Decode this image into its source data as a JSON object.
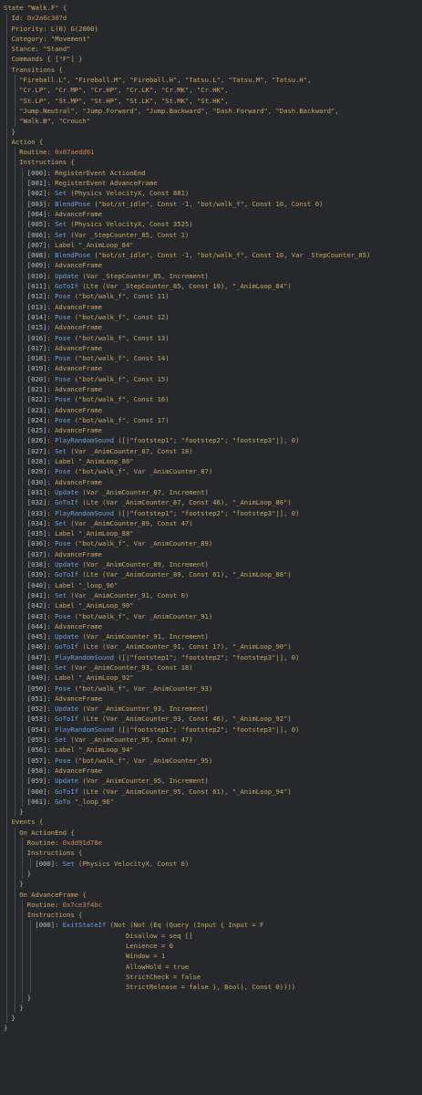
{
  "lines": [
    {
      "d": 0,
      "s": [
        [
          "k",
          "State \"Walk.F\" {"
        ]
      ]
    },
    {
      "d": 1,
      "s": [
        [
          "k",
          "Id: "
        ],
        [
          "n",
          "0x2a6c307d"
        ]
      ]
    },
    {
      "d": 1,
      "s": [
        [
          "k",
          "Priority: L(0) G(2000)"
        ]
      ]
    },
    {
      "d": 1,
      "s": [
        [
          "k",
          "Category: \"Movement\""
        ]
      ]
    },
    {
      "d": 1,
      "s": [
        [
          "k",
          "Stance: \"Stand\""
        ]
      ]
    },
    {
      "d": 1,
      "s": [
        [
          "k",
          "Commands { [\"F\"] }"
        ]
      ]
    },
    {
      "d": 1,
      "s": [
        [
          "k",
          "Transitions {"
        ]
      ]
    },
    {
      "d": 2,
      "s": [
        [
          "s",
          "\"Fireball.L\", \"Fireball.M\", \"Fireball.H\", \"Tatsu.L\", \"Tatsu.M\", \"Tatsu.H\","
        ]
      ]
    },
    {
      "d": 2,
      "s": [
        [
          "s",
          "\"Cr.LP\", \"Cr.MP\", \"Cr.HP\", \"Cr.LK\", \"Cr.MK\", \"Cr.HK\","
        ]
      ]
    },
    {
      "d": 2,
      "s": [
        [
          "s",
          "\"St.LP\", \"St.MP\", \"St.HP\", \"St.LK\", \"St.MK\", \"St.HK\","
        ]
      ]
    },
    {
      "d": 2,
      "s": [
        [
          "s",
          "\"Jump.Neutral\", \"Jump.Forward\", \"Jump.Backward\", \"Dash.Forward\", \"Dash.Backward\","
        ]
      ]
    },
    {
      "d": 2,
      "s": [
        [
          "s",
          "\"Walk.B\", \"Crouch\""
        ]
      ]
    },
    {
      "d": 1,
      "s": [
        [
          "p",
          "}"
        ]
      ]
    },
    {
      "d": 1,
      "s": [
        [
          "k",
          "Action {"
        ]
      ]
    },
    {
      "d": 2,
      "s": [
        [
          "k",
          "Routine: "
        ],
        [
          "n",
          "0x87aedd61"
        ]
      ]
    },
    {
      "d": 2,
      "s": [
        [
          "k",
          "Instructions {"
        ]
      ]
    },
    {
      "d": 3,
      "s": [
        [
          "p",
          "[000]: "
        ],
        [
          "k",
          "RegisterEvent ActionEnd"
        ]
      ]
    },
    {
      "d": 3,
      "s": [
        [
          "p",
          "[001]: "
        ],
        [
          "k",
          "RegisterEvent AdvanceFrame"
        ]
      ]
    },
    {
      "d": 3,
      "s": [
        [
          "p",
          "[002]: "
        ],
        [
          "b",
          "Set"
        ],
        [
          "k",
          " (Physics VelocityX, Const 881)"
        ]
      ]
    },
    {
      "d": 3,
      "s": [
        [
          "p",
          "[003]: "
        ],
        [
          "b",
          "BlendPose"
        ],
        [
          "k",
          " (\"bot/st_idle\", Const -1, \"bot/walk_f\", Const 10, Const 0)"
        ]
      ]
    },
    {
      "d": 3,
      "s": [
        [
          "p",
          "[004]: "
        ],
        [
          "k",
          "AdvanceFrame"
        ]
      ]
    },
    {
      "d": 3,
      "s": [
        [
          "p",
          "[005]: "
        ],
        [
          "b",
          "Set"
        ],
        [
          "k",
          " (Physics VelocityX, Const 3525)"
        ]
      ]
    },
    {
      "d": 3,
      "s": [
        [
          "p",
          "[006]: "
        ],
        [
          "b",
          "Set"
        ],
        [
          "k",
          " (Var _StepCounter_85, Const 1)"
        ]
      ]
    },
    {
      "d": 3,
      "s": [
        [
          "p",
          "[007]: "
        ],
        [
          "k",
          "Label \"_AnimLoop_84\""
        ]
      ]
    },
    {
      "d": 3,
      "s": [
        [
          "p",
          "[008]: "
        ],
        [
          "b",
          "BlendPose"
        ],
        [
          "k",
          " (\"bot/st_idle\", Const -1, \"bot/walk_f\", Const 10, Var _StepCounter_85)"
        ]
      ]
    },
    {
      "d": 3,
      "s": [
        [
          "p",
          "[009]: "
        ],
        [
          "k",
          "AdvanceFrame"
        ]
      ]
    },
    {
      "d": 3,
      "s": [
        [
          "p",
          "[010]: "
        ],
        [
          "b",
          "Update"
        ],
        [
          "k",
          " (Var _StepCounter_85, Increment)"
        ]
      ]
    },
    {
      "d": 3,
      "s": [
        [
          "p",
          "[011]: "
        ],
        [
          "b",
          "GoToIf"
        ],
        [
          "k",
          " (Lte (Var _StepCounter_85, Const 10), \"_AnimLoop_84\")"
        ]
      ]
    },
    {
      "d": 3,
      "s": [
        [
          "p",
          "[012]: "
        ],
        [
          "b",
          "Pose"
        ],
        [
          "k",
          " (\"bot/walk_f\", Const 11)"
        ]
      ]
    },
    {
      "d": 3,
      "s": [
        [
          "p",
          "[013]: "
        ],
        [
          "k",
          "AdvanceFrame"
        ]
      ]
    },
    {
      "d": 3,
      "s": [
        [
          "p",
          "[014]: "
        ],
        [
          "b",
          "Pose"
        ],
        [
          "k",
          " (\"bot/walk_f\", Const 12)"
        ]
      ]
    },
    {
      "d": 3,
      "s": [
        [
          "p",
          "[015]: "
        ],
        [
          "k",
          "AdvanceFrame"
        ]
      ]
    },
    {
      "d": 3,
      "s": [
        [
          "p",
          "[016]: "
        ],
        [
          "b",
          "Pose"
        ],
        [
          "k",
          " (\"bot/walk_f\", Const 13)"
        ]
      ]
    },
    {
      "d": 3,
      "s": [
        [
          "p",
          "[017]: "
        ],
        [
          "k",
          "AdvanceFrame"
        ]
      ]
    },
    {
      "d": 3,
      "s": [
        [
          "p",
          "[018]: "
        ],
        [
          "b",
          "Pose"
        ],
        [
          "k",
          " (\"bot/walk_f\", Const 14)"
        ]
      ]
    },
    {
      "d": 3,
      "s": [
        [
          "p",
          "[019]: "
        ],
        [
          "k",
          "AdvanceFrame"
        ]
      ]
    },
    {
      "d": 3,
      "s": [
        [
          "p",
          "[020]: "
        ],
        [
          "b",
          "Pose"
        ],
        [
          "k",
          " (\"bot/walk_f\", Const 15)"
        ]
      ]
    },
    {
      "d": 3,
      "s": [
        [
          "p",
          "[021]: "
        ],
        [
          "k",
          "AdvanceFrame"
        ]
      ]
    },
    {
      "d": 3,
      "s": [
        [
          "p",
          "[022]: "
        ],
        [
          "b",
          "Pose"
        ],
        [
          "k",
          " (\"bot/walk_f\", Const 16)"
        ]
      ]
    },
    {
      "d": 3,
      "s": [
        [
          "p",
          "[023]: "
        ],
        [
          "k",
          "AdvanceFrame"
        ]
      ]
    },
    {
      "d": 3,
      "s": [
        [
          "p",
          "[024]: "
        ],
        [
          "b",
          "Pose"
        ],
        [
          "k",
          " (\"bot/walk_f\", Const 17)"
        ]
      ]
    },
    {
      "d": 3,
      "s": [
        [
          "p",
          "[025]: "
        ],
        [
          "k",
          "AdvanceFrame"
        ]
      ]
    },
    {
      "d": 3,
      "s": [
        [
          "p",
          "[026]: "
        ],
        [
          "b",
          "PlayRandomSound"
        ],
        [
          "k",
          " ([|\"footstep1\"; \"footstep2\"; \"footstep3\"|], 0)"
        ]
      ]
    },
    {
      "d": 3,
      "s": [
        [
          "p",
          "[027]: "
        ],
        [
          "b",
          "Set"
        ],
        [
          "k",
          " (Var _AnimCounter_87, Const 18)"
        ]
      ]
    },
    {
      "d": 3,
      "s": [
        [
          "p",
          "[028]: "
        ],
        [
          "k",
          "Label \"_AnimLoop_86\""
        ]
      ]
    },
    {
      "d": 3,
      "s": [
        [
          "p",
          "[029]: "
        ],
        [
          "b",
          "Pose"
        ],
        [
          "k",
          " (\"bot/walk_f\", Var _AnimCounter_87)"
        ]
      ]
    },
    {
      "d": 3,
      "s": [
        [
          "p",
          "[030]: "
        ],
        [
          "k",
          "AdvanceFrame"
        ]
      ]
    },
    {
      "d": 3,
      "s": [
        [
          "p",
          "[031]: "
        ],
        [
          "b",
          "Update"
        ],
        [
          "k",
          " (Var _AnimCounter_87, Increment)"
        ]
      ]
    },
    {
      "d": 3,
      "s": [
        [
          "p",
          "[032]: "
        ],
        [
          "b",
          "GoToIf"
        ],
        [
          "k",
          " (Lte (Var _AnimCounter_87, Const 46), \"_AnimLoop_86\")"
        ]
      ]
    },
    {
      "d": 3,
      "s": [
        [
          "p",
          "[033]: "
        ],
        [
          "b",
          "PlayRandomSound"
        ],
        [
          "k",
          " ([|\"footstep1\"; \"footstep2\"; \"footstep3\"|], 0)"
        ]
      ]
    },
    {
      "d": 3,
      "s": [
        [
          "p",
          "[034]: "
        ],
        [
          "b",
          "Set"
        ],
        [
          "k",
          " (Var _AnimCounter_89, Const 47)"
        ]
      ]
    },
    {
      "d": 3,
      "s": [
        [
          "p",
          "[035]: "
        ],
        [
          "k",
          "Label \"_AnimLoop_88\""
        ]
      ]
    },
    {
      "d": 3,
      "s": [
        [
          "p",
          "[036]: "
        ],
        [
          "b",
          "Pose"
        ],
        [
          "k",
          " (\"bot/walk_f\", Var _AnimCounter_89)"
        ]
      ]
    },
    {
      "d": 3,
      "s": [
        [
          "p",
          "[037]: "
        ],
        [
          "k",
          "AdvanceFrame"
        ]
      ]
    },
    {
      "d": 3,
      "s": [
        [
          "p",
          "[038]: "
        ],
        [
          "b",
          "Update"
        ],
        [
          "k",
          " (Var _AnimCounter_89, Increment)"
        ]
      ]
    },
    {
      "d": 3,
      "s": [
        [
          "p",
          "[039]: "
        ],
        [
          "b",
          "GoToIf"
        ],
        [
          "k",
          " (Lte (Var _AnimCounter_89, Const 61), \"_AnimLoop_88\")"
        ]
      ]
    },
    {
      "d": 3,
      "s": [
        [
          "p",
          "[040]: "
        ],
        [
          "k",
          "Label \"_loop_96\""
        ]
      ]
    },
    {
      "d": 3,
      "s": [
        [
          "p",
          "[041]: "
        ],
        [
          "b",
          "Set"
        ],
        [
          "k",
          " (Var _AnimCounter_91, Const 0)"
        ]
      ]
    },
    {
      "d": 3,
      "s": [
        [
          "p",
          "[042]: "
        ],
        [
          "k",
          "Label \"_AnimLoop_90\""
        ]
      ]
    },
    {
      "d": 3,
      "s": [
        [
          "p",
          "[043]: "
        ],
        [
          "b",
          "Pose"
        ],
        [
          "k",
          " (\"bot/walk_f\", Var _AnimCounter_91)"
        ]
      ]
    },
    {
      "d": 3,
      "s": [
        [
          "p",
          "[044]: "
        ],
        [
          "k",
          "AdvanceFrame"
        ]
      ]
    },
    {
      "d": 3,
      "s": [
        [
          "p",
          "[045]: "
        ],
        [
          "b",
          "Update"
        ],
        [
          "k",
          " (Var _AnimCounter_91, Increment)"
        ]
      ]
    },
    {
      "d": 3,
      "s": [
        [
          "p",
          "[046]: "
        ],
        [
          "b",
          "GoToIf"
        ],
        [
          "k",
          " (Lte (Var _AnimCounter_91, Const 17), \"_AnimLoop_90\")"
        ]
      ]
    },
    {
      "d": 3,
      "s": [
        [
          "p",
          "[047]: "
        ],
        [
          "b",
          "PlayRandomSound"
        ],
        [
          "k",
          " ([|\"footstep1\"; \"footstep2\"; \"footstep3\"|], 0)"
        ]
      ]
    },
    {
      "d": 3,
      "s": [
        [
          "p",
          "[048]: "
        ],
        [
          "b",
          "Set"
        ],
        [
          "k",
          " (Var _AnimCounter_93, Const 18)"
        ]
      ]
    },
    {
      "d": 3,
      "s": [
        [
          "p",
          "[049]: "
        ],
        [
          "k",
          "Label \"_AnimLoop_92\""
        ]
      ]
    },
    {
      "d": 3,
      "s": [
        [
          "p",
          "[050]: "
        ],
        [
          "b",
          "Pose"
        ],
        [
          "k",
          " (\"bot/walk_f\", Var _AnimCounter_93)"
        ]
      ]
    },
    {
      "d": 3,
      "s": [
        [
          "p",
          "[051]: "
        ],
        [
          "k",
          "AdvanceFrame"
        ]
      ]
    },
    {
      "d": 3,
      "s": [
        [
          "p",
          "[052]: "
        ],
        [
          "b",
          "Update"
        ],
        [
          "k",
          " (Var _AnimCounter_93, Increment)"
        ]
      ]
    },
    {
      "d": 3,
      "s": [
        [
          "p",
          "[053]: "
        ],
        [
          "b",
          "GoToIf"
        ],
        [
          "k",
          " (Lte (Var _AnimCounter_93, Const 46), \"_AnimLoop_92\")"
        ]
      ]
    },
    {
      "d": 3,
      "s": [
        [
          "p",
          "[054]: "
        ],
        [
          "b",
          "PlayRandomSound"
        ],
        [
          "k",
          " ([|\"footstep1\"; \"footstep2\"; \"footstep3\"|], 0)"
        ]
      ]
    },
    {
      "d": 3,
      "s": [
        [
          "p",
          "[055]: "
        ],
        [
          "b",
          "Set"
        ],
        [
          "k",
          " (Var _AnimCounter_95, Const 47)"
        ]
      ]
    },
    {
      "d": 3,
      "s": [
        [
          "p",
          "[056]: "
        ],
        [
          "k",
          "Label \"_AnimLoop_94\""
        ]
      ]
    },
    {
      "d": 3,
      "s": [
        [
          "p",
          "[057]: "
        ],
        [
          "b",
          "Pose"
        ],
        [
          "k",
          " (\"bot/walk_f\", Var _AnimCounter_95)"
        ]
      ]
    },
    {
      "d": 3,
      "s": [
        [
          "p",
          "[058]: "
        ],
        [
          "k",
          "AdvanceFrame"
        ]
      ]
    },
    {
      "d": 3,
      "s": [
        [
          "p",
          "[059]: "
        ],
        [
          "b",
          "Update"
        ],
        [
          "k",
          " (Var _AnimCounter_95, Increment)"
        ]
      ]
    },
    {
      "d": 3,
      "s": [
        [
          "p",
          "[060]: "
        ],
        [
          "b",
          "GoToIf"
        ],
        [
          "k",
          " (Lte (Var _AnimCounter_95, Const 61), \"_AnimLoop_94\")"
        ]
      ]
    },
    {
      "d": 3,
      "s": [
        [
          "p",
          "[061]: "
        ],
        [
          "b",
          "GoTo"
        ],
        [
          "k",
          " \"_loop_96\""
        ]
      ]
    },
    {
      "d": 2,
      "s": [
        [
          "p",
          "}"
        ]
      ]
    },
    {
      "d": 1,
      "s": [
        [
          "k",
          "Events {"
        ]
      ]
    },
    {
      "d": 2,
      "s": [
        [
          "k",
          "On ActionEnd {"
        ]
      ]
    },
    {
      "d": 3,
      "s": [
        [
          "k",
          "Routine: "
        ],
        [
          "n",
          "0xdd91d78e"
        ]
      ]
    },
    {
      "d": 3,
      "s": [
        [
          "k",
          "Instructions {"
        ]
      ]
    },
    {
      "d": 4,
      "s": [
        [
          "p",
          "[000]: "
        ],
        [
          "b",
          "Set"
        ],
        [
          "k",
          " (Physics VelocityX, Const 0)"
        ]
      ]
    },
    {
      "d": 3,
      "s": [
        [
          "p",
          "}"
        ]
      ]
    },
    {
      "d": 2,
      "s": [
        [
          "p",
          "}"
        ]
      ]
    },
    {
      "d": 2,
      "s": [
        [
          "k",
          "On AdvanceFrame {"
        ]
      ]
    },
    {
      "d": 3,
      "s": [
        [
          "k",
          "Routine: "
        ],
        [
          "n",
          "0x7ce3f4bc"
        ]
      ]
    },
    {
      "d": 3,
      "s": [
        [
          "k",
          "Instructions {"
        ]
      ]
    },
    {
      "d": 4,
      "s": [
        [
          "p",
          "[000]: "
        ],
        [
          "b",
          "ExitStateIf"
        ],
        [
          "k",
          " (Not (Not (Eq (Query (Input { Input = F"
        ]
      ]
    },
    {
      "d": 4,
      "x": 23,
      "s": [
        [
          "k",
          "Disallow = seq []"
        ]
      ]
    },
    {
      "d": 4,
      "x": 23,
      "s": [
        [
          "k",
          "Lenience = 0"
        ]
      ]
    },
    {
      "d": 4,
      "x": 23,
      "s": [
        [
          "k",
          "Window = 1"
        ]
      ]
    },
    {
      "d": 4,
      "x": 23,
      "s": [
        [
          "k",
          "AllowHold = true"
        ]
      ]
    },
    {
      "d": 4,
      "x": 23,
      "s": [
        [
          "k",
          "StrictCheck = false"
        ]
      ]
    },
    {
      "d": 4,
      "x": 23,
      "s": [
        [
          "k",
          "StrictRelease = false }, Bool), Const 0))))"
        ]
      ]
    },
    {
      "d": 3,
      "s": [
        [
          "p",
          "}"
        ]
      ]
    },
    {
      "d": 2,
      "s": [
        [
          "p",
          "}"
        ]
      ]
    },
    {
      "d": 1,
      "s": [
        [
          "p",
          "}"
        ]
      ]
    },
    {
      "d": 0,
      "s": [
        [
          "p",
          "}"
        ]
      ]
    }
  ]
}
